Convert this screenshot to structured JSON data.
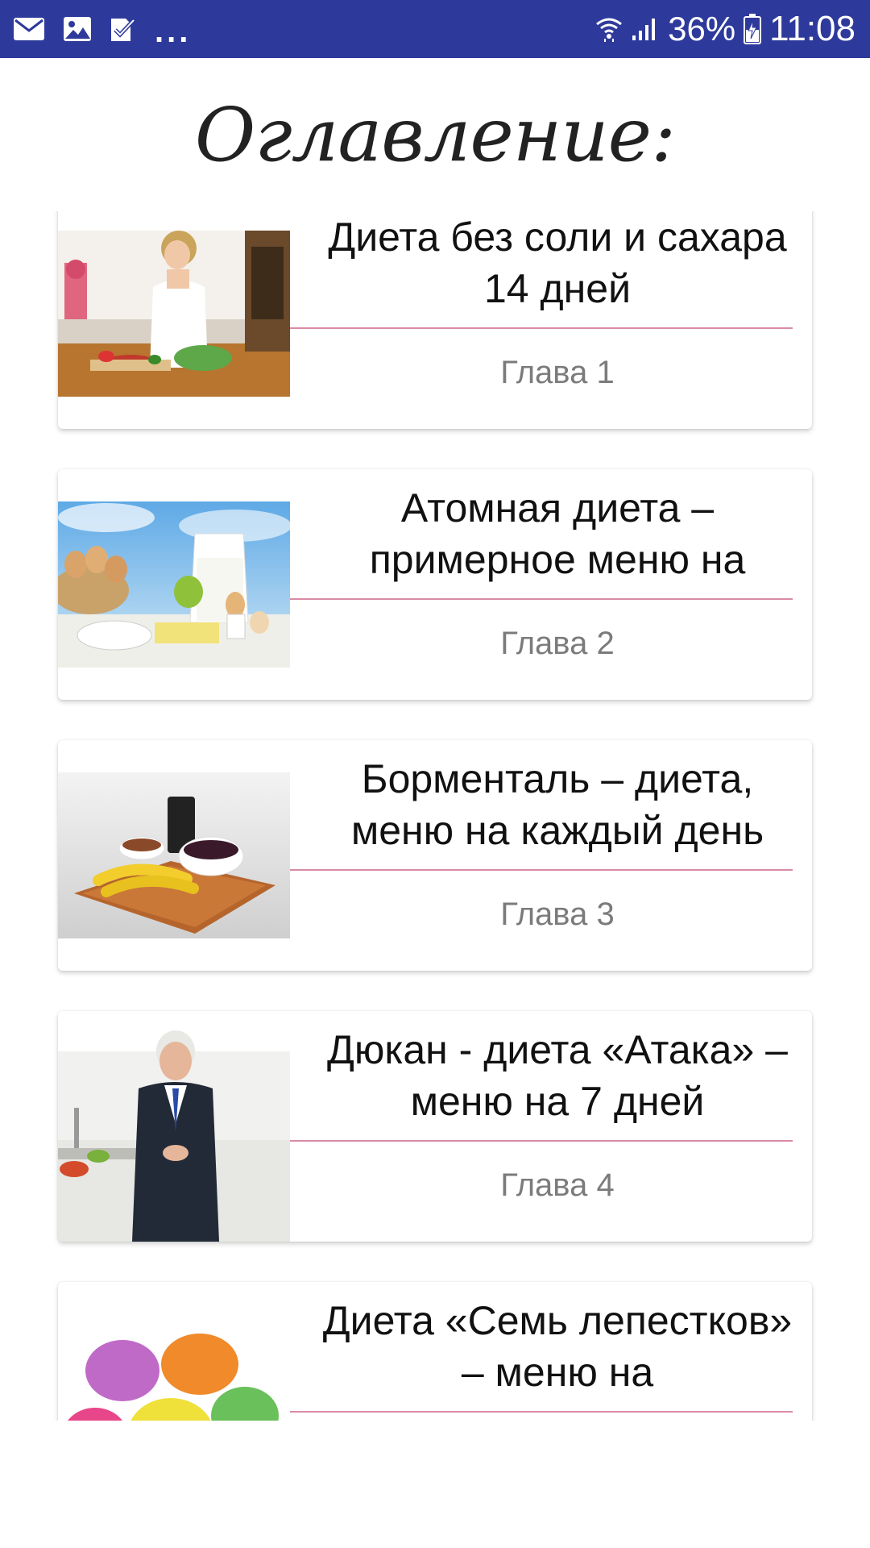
{
  "status_bar": {
    "notification_icons": [
      "mail-icon",
      "image-icon",
      "task-check-icon"
    ],
    "overflow": "...",
    "battery_percent": "36%",
    "time": "11:08",
    "background_color": "#2e3a9b"
  },
  "header": {
    "title": "Оглавление:"
  },
  "chapters": [
    {
      "title": "Диета без соли и сахара 14 дней",
      "label": "Глава 1",
      "image": "woman-cooking-salad"
    },
    {
      "title": "Атомная диета – примерное меню на",
      "label": "Глава 2",
      "image": "eggs-milk-cheese-apple"
    },
    {
      "title": "Борменталь – диета, меню на каждый день",
      "label": "Глава 3",
      "image": "bananas-buckwheat-tray"
    },
    {
      "title": "Дюкан - диета «Атака» – меню на 7 дней",
      "label": "Глава 4",
      "image": "man-in-suit-kitchen"
    },
    {
      "title": "Диета «Семь лепестков» – меню на",
      "label": "",
      "image": "seven-petals-flower"
    }
  ],
  "colors": {
    "divider": "#d98aa8",
    "chapter_label": "#7b7b7b"
  }
}
